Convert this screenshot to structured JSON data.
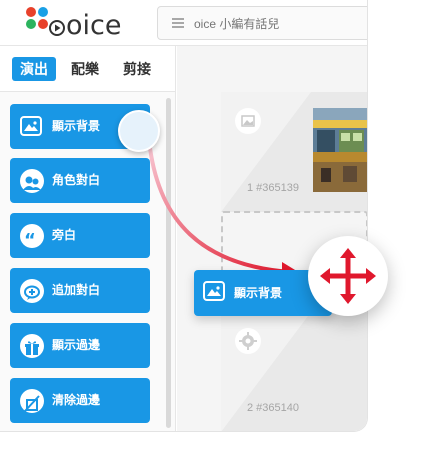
{
  "app": {
    "logo_text": "oice",
    "logo_colors": [
      "#e8412b",
      "#1aa0e6",
      "#2cb35e",
      "#e8412b"
    ]
  },
  "search": {
    "placeholder": "oice 小編有話兒"
  },
  "tabs": [
    {
      "label": "演出",
      "active": true
    },
    {
      "label": "配樂",
      "active": false
    },
    {
      "label": "剪接",
      "active": false
    }
  ],
  "sidebar": {
    "items": [
      {
        "label": "顯示背景",
        "icon": "image-icon"
      },
      {
        "label": "角色對白",
        "icon": "characters-icon"
      },
      {
        "label": "旁白",
        "icon": "quote-icon"
      },
      {
        "label": "追加對白",
        "icon": "add-dialogue-icon"
      },
      {
        "label": "顯示過邊",
        "icon": "gift-icon"
      },
      {
        "label": "清除過邊",
        "icon": "clear-icon"
      }
    ]
  },
  "canvas": {
    "slots": [
      {
        "label": "1 #365139"
      },
      {
        "label": "2 #365140"
      }
    ]
  },
  "drag": {
    "label": "顯示背景",
    "icon": "image-icon"
  },
  "colors": {
    "accent": "#1997e5",
    "move_arrow": "#e0182d"
  }
}
